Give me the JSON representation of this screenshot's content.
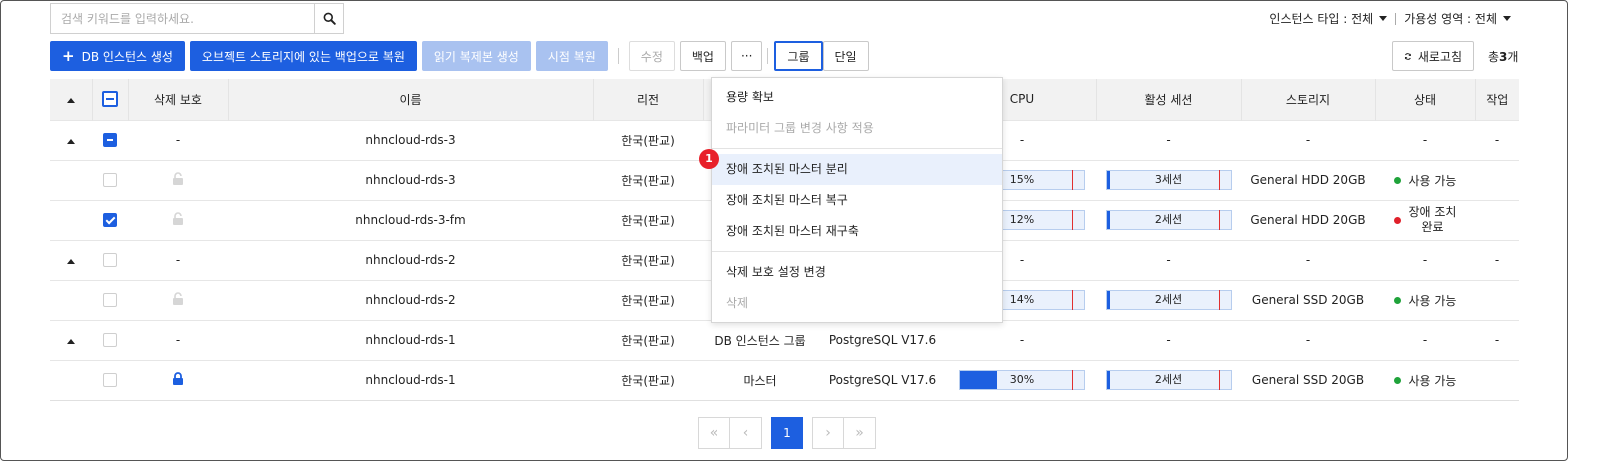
{
  "search": {
    "placeholder": "검색 키워드를 입력하세요."
  },
  "filters": {
    "instance_type": "인스턴스 타입 : 전체",
    "availability_zone": "가용성 영역 : 전체"
  },
  "toolbar": {
    "create": "DB 인스턴스 생성",
    "restore_object": "오브젝트 스토리지에 있는 백업으로 복원",
    "read_replica": "읽기 복제본 생성",
    "pitr": "시점 복원",
    "edit": "수정",
    "backup": "백업",
    "more": "···",
    "group": "그룹",
    "single": "단일",
    "refresh": "새로고침"
  },
  "total": {
    "prefix": "총",
    "count": "3",
    "suffix": "개"
  },
  "table": {
    "headers": {
      "delete_protect": "삭제 보호",
      "name": "이름",
      "region": "리전",
      "cpu": "CPU",
      "sessions": "활성 세션",
      "storage": "스토리지",
      "status": "상태",
      "action": "작업"
    },
    "rows": [
      {
        "protect": "-",
        "name": "nhncloud-rds-3",
        "region": "한국(판교)",
        "cpu": "-",
        "sessions": "-",
        "storage": "-",
        "status": "-",
        "action": "-"
      },
      {
        "name": "nhncloud-rds-3",
        "region": "한국(판교)",
        "cpu": "15%",
        "sessions": "3세션",
        "storage": "General HDD 20GB",
        "status": "사용 가능"
      },
      {
        "name": "nhncloud-rds-3-fm",
        "region": "한국(판교)",
        "cpu": "12%",
        "sessions": "2세션",
        "storage": "General HDD 20GB",
        "status_l1": "장애 조치",
        "status_l2": "완료"
      },
      {
        "protect": "-",
        "name": "nhncloud-rds-2",
        "region": "한국(판교)",
        "cpu": "-",
        "sessions": "-",
        "storage": "-",
        "status": "-",
        "action": "-"
      },
      {
        "name": "nhncloud-rds-2",
        "region": "한국(판교)",
        "cpu": "14%",
        "sessions": "2세션",
        "storage": "General SSD 20GB",
        "status": "사용 가능"
      },
      {
        "protect": "-",
        "name": "nhncloud-rds-1",
        "region": "한국(판교)",
        "type": "DB 인스턴스 그룹",
        "version": "PostgreSQL V17.6",
        "cpu": "-",
        "sessions": "-",
        "storage": "-",
        "status": "-",
        "action": "-"
      },
      {
        "name": "nhncloud-rds-1",
        "region": "한국(판교)",
        "type": "마스터",
        "version": "PostgreSQL V17.6",
        "cpu": "30%",
        "sessions": "2세션",
        "storage": "General SSD 20GB",
        "status": "사용 가능"
      }
    ]
  },
  "progress": {
    "cpu": [
      0.15,
      0.12,
      0.14,
      0.3
    ]
  },
  "menu": {
    "items": [
      "용량 확보",
      "파라미터 그룹 변경 사항 적용",
      "장애 조치된 마스터 분리",
      "장애 조치된 마스터 복구",
      "장애 조치된 마스터 재구축",
      "삭제 보호 설정 변경",
      "삭제"
    ]
  },
  "badge": "1",
  "pagination": {
    "first": "«",
    "prev": "‹",
    "current": "1",
    "next": "›",
    "last": "»"
  },
  "colors": {
    "primary": "#1d5fe0",
    "green": "#1fa33a",
    "red": "#e0202a"
  }
}
